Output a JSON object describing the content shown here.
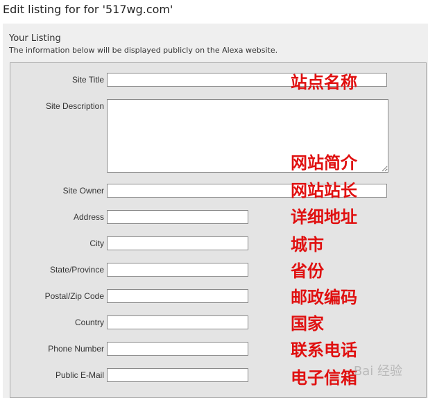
{
  "page_title": "Edit listing for for '517wg.com'",
  "section": {
    "title": "Your Listing",
    "description": "The information below will be displayed publicly on the Alexa website."
  },
  "fields": {
    "site_title": {
      "label": "Site Title",
      "value": "",
      "annotation": "站点名称"
    },
    "site_description": {
      "label": "Site Description",
      "value": "",
      "annotation": "网站简介"
    },
    "site_owner": {
      "label": "Site Owner",
      "value": "",
      "annotation": "网站站长"
    },
    "address": {
      "label": "Address",
      "value": "",
      "annotation": "详细地址"
    },
    "city": {
      "label": "City",
      "value": "",
      "annotation": "城市"
    },
    "state": {
      "label": "State/Province",
      "value": "",
      "annotation": "省份"
    },
    "postal": {
      "label": "Postal/Zip Code",
      "value": "",
      "annotation": "邮政编码"
    },
    "country": {
      "label": "Country",
      "value": "",
      "annotation": "国家"
    },
    "phone": {
      "label": "Phone Number",
      "value": "",
      "annotation": "联系电话"
    },
    "email": {
      "label": "Public E-Mail",
      "value": "",
      "annotation": "电子信箱"
    }
  },
  "watermark": "Bai 经验",
  "colors": {
    "annotation": "#e01010",
    "panel": "#efefef",
    "form_box": "#e4e4e4"
  }
}
